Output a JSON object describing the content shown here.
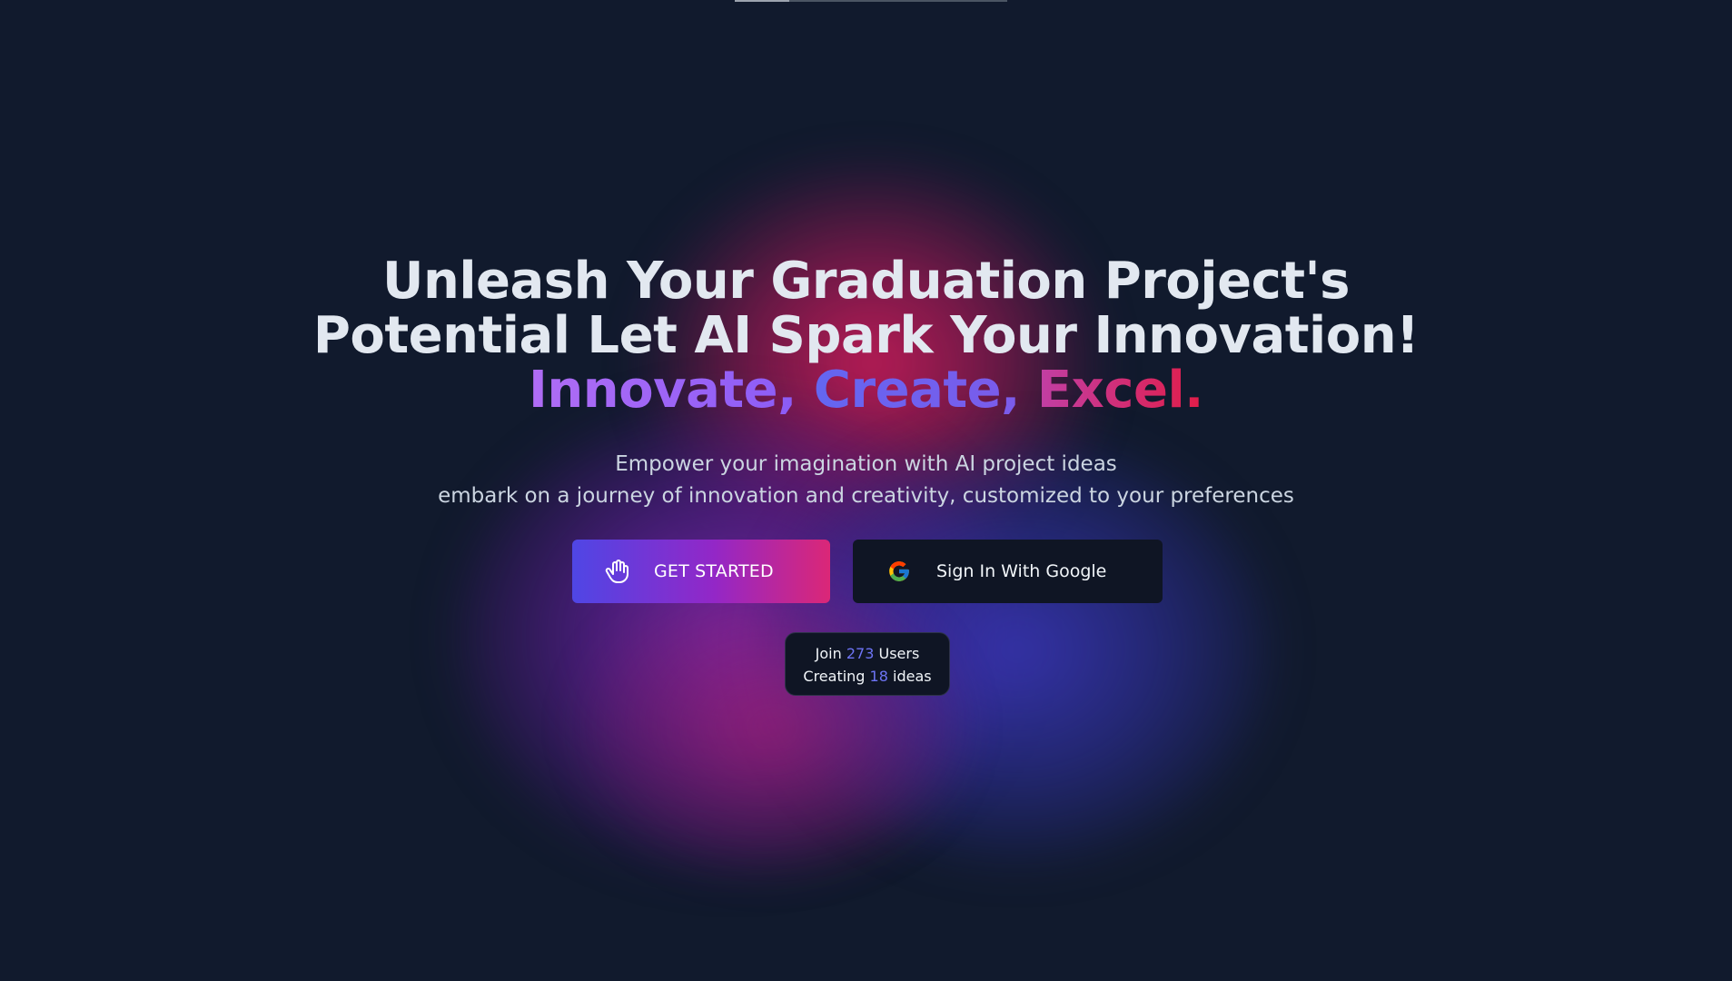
{
  "hero": {
    "headline_line1": "Unleash Your Graduation Project's",
    "headline_line2": "Potential Let AI Spark Your Innovation!",
    "tagline": {
      "word1": "Innovate,",
      "word2": "Create,",
      "word3": "Excel."
    },
    "subtitle_line1": "Empower your imagination with AI project ideas",
    "subtitle_line2": "embark on a journey of innovation and creativity, customized to your preferences"
  },
  "actions": {
    "get_started_label": "GET STARTED",
    "get_started_icon": "hand-icon",
    "google_label": "Sign In With Google",
    "google_icon": "google-icon"
  },
  "stats": {
    "join_prefix": "Join",
    "users_count": "273",
    "users_suffix": "Users",
    "creating_prefix": "Creating",
    "ideas_count": "18",
    "ideas_suffix": "ideas"
  },
  "colors": {
    "background": "#111a2d",
    "headline": "#e2e8f0",
    "accent_blue": "#6366f1",
    "accent_purple": "#9327c7",
    "accent_pink": "#db2777",
    "button_dark": "#0f1524"
  }
}
